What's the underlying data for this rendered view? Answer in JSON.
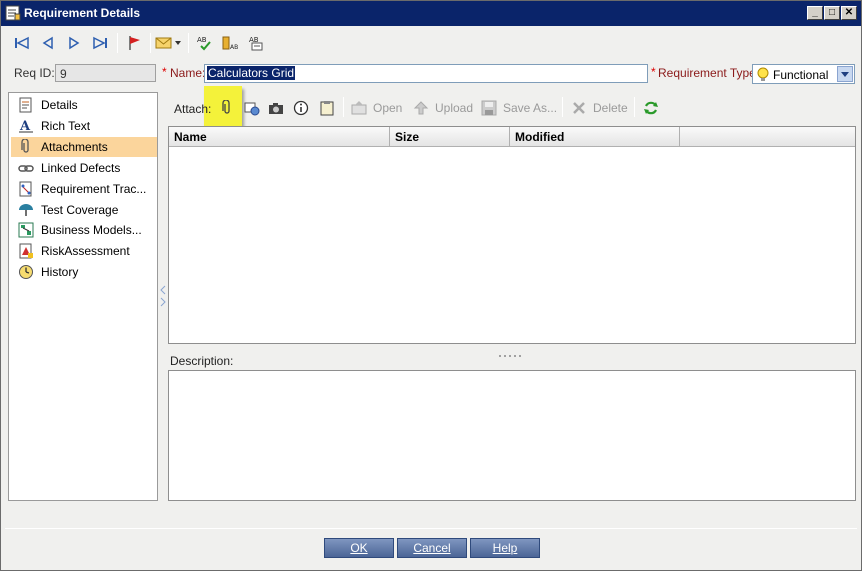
{
  "window": {
    "title": "Requirement Details"
  },
  "window_controls": {
    "minimize": "_",
    "maximize": "□",
    "close": "✕"
  },
  "toolbar": {
    "buttons": [
      "first-record-icon",
      "previous-record-icon",
      "next-record-icon",
      "last-record-icon",
      "flag-icon",
      "email-icon",
      "spell-check-icon",
      "thesaurus-icon",
      "spelling-options-icon"
    ]
  },
  "form": {
    "req_id_label": "Req ID:",
    "req_id_value": "9",
    "name_star": "*",
    "name_label": "Name:",
    "name_value": "Calculators Grid",
    "type_star": "*",
    "type_label": "Requirement Type:",
    "type_value": "Functional"
  },
  "sidebar": {
    "items": [
      {
        "label": "Details",
        "icon": "details-icon"
      },
      {
        "label": "Rich Text",
        "icon": "rich-text-icon"
      },
      {
        "label": "Attachments",
        "icon": "paperclip-icon",
        "active": true
      },
      {
        "label": "Linked Defects",
        "icon": "link-icon"
      },
      {
        "label": "Requirement Trac...",
        "icon": "traceability-icon"
      },
      {
        "label": "Test Coverage",
        "icon": "umbrella-icon"
      },
      {
        "label": "Business Models...",
        "icon": "business-model-icon"
      },
      {
        "label": "RiskAssessment",
        "icon": "risk-icon"
      },
      {
        "label": "History",
        "icon": "history-icon"
      }
    ]
  },
  "attachments": {
    "attach_label": "Attach:",
    "open_label": "Open",
    "upload_label": "Upload",
    "save_as_label": "Save As...",
    "delete_label": "Delete",
    "columns": [
      "Name",
      "Size",
      "Modified",
      ""
    ],
    "rows": []
  },
  "description": {
    "label": "Description:"
  },
  "buttons": {
    "ok": "OK",
    "cancel": "Cancel",
    "help": "Help"
  },
  "colors": {
    "title_bar": "#0a246a",
    "active_item": "#fbd59c",
    "highlight": "#f4f23a",
    "dialog_button": "#5a74a8",
    "required_star": "#dd0000"
  }
}
